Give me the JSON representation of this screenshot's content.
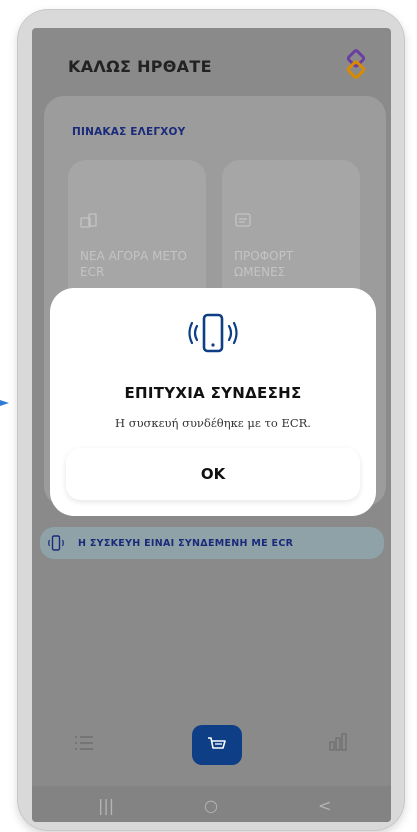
{
  "header": {
    "title": "ΚΑΛΩΣ ΗΡΘΑΤΕ",
    "logo_icon": "brand-logo"
  },
  "dashboard": {
    "heading": "ΠΙΝΑΚΑΣ ΕΛΕΓΧΟΥ",
    "tiles": [
      {
        "icon": "pos-terminal-icon",
        "label": "ΝΕΑ ΑΓΟΡΑ ΜΕΤΟ ECR"
      },
      {
        "icon": "receipt-icon",
        "label": "ΠΡΟΦΟΡΤ ΩΜΕΝΕΣ"
      }
    ]
  },
  "status": {
    "icon": "phone-vibrate-icon",
    "text": "Η ΣΥΣΚΕΥΗ ΕΙΝΑΙ ΣΥΝΔΕΜΕΝΗ ΜΕ ECR"
  },
  "dialog": {
    "icon": "phone-vibrate-icon",
    "title": "ΕΠΙΤΥΧΙΑ ΣΥΝΔΕΣΗΣ",
    "message": "Η συσκευή συνδέθηκε με το ECR.",
    "ok_label": "OK"
  },
  "bottom_nav": {
    "items": [
      "list-icon",
      "cart-icon",
      "stats-icon"
    ],
    "active": "cart-icon"
  },
  "system_nav": {
    "recents": "|||",
    "home": "○",
    "back": "<"
  },
  "colors": {
    "accent": "#0d3e86",
    "heading_blue": "#1a2a7a"
  }
}
